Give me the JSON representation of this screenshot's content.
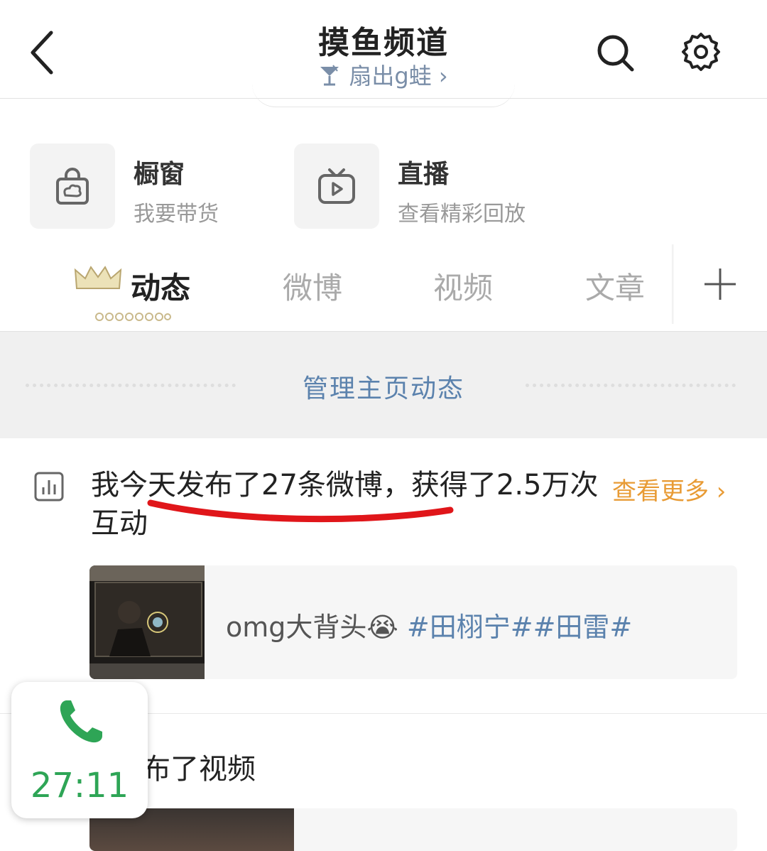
{
  "header": {
    "title": "摸鱼频道",
    "subtitle": "扇出g蛙 ›"
  },
  "shortcuts": [
    {
      "title": "橱窗",
      "subtitle": "我要带货",
      "icon": "shopping-bag-icon"
    },
    {
      "title": "直播",
      "subtitle": "查看精彩回放",
      "icon": "tv-play-icon"
    }
  ],
  "tabs": [
    "动态",
    "微博",
    "视频",
    "文章"
  ],
  "manage": {
    "label": "管理主页动态"
  },
  "stats": {
    "text": "我今天发布了27条微博，获得了2.5万次互动",
    "more": "查看更多 ›"
  },
  "post": {
    "text": "omg大背头",
    "emoji": "😭",
    "hashtags": "#田栩宁##田雷#"
  },
  "video_post": {
    "text": "布了视频"
  },
  "call": {
    "time": "27:11"
  },
  "colors": {
    "link_blue": "#5b82ad",
    "orange": "#e89b35",
    "call_green": "#2ea556",
    "underline_red": "#e0161a"
  }
}
